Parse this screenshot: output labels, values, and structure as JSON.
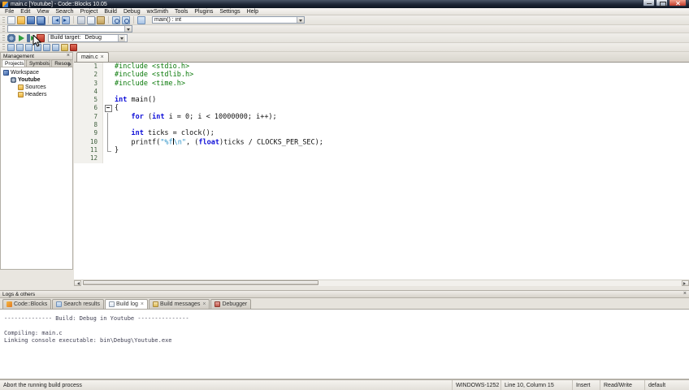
{
  "window": {
    "title": "main.c [Youtube] - Code::Blocks 10.05"
  },
  "glyphs": {
    "close": "×"
  },
  "colors": {
    "title_bar": "#1d2635",
    "keyword": "#0e0ed8",
    "preprocessor": "#0a7a0a",
    "string": "#2e93c8",
    "run_green": "#2f9e3f",
    "abort_red": "#b53224"
  },
  "menu_bar": {
    "items": [
      "File",
      "Edit",
      "View",
      "Search",
      "Project",
      "Build",
      "Debug",
      "wxSmith",
      "Tools",
      "Plugins",
      "Settings",
      "Help"
    ]
  },
  "toolbars": {
    "main_icons": [
      "new-file",
      "open-file",
      "save",
      "save-all",
      "|",
      "undo",
      "redo",
      "|",
      "cut",
      "copy",
      "paste",
      "|",
      "find",
      "replace",
      "|",
      "goto-line"
    ],
    "symbol_combo_value": "main() : int",
    "search_combo_value": "",
    "compiler_icons": [
      "build",
      "run",
      "build-and-run",
      "abort"
    ],
    "build_target_label": "Build target:",
    "build_target_value": "Debug",
    "debugger_icons": [
      "debug-continue",
      "run-to-cursor",
      "next-line",
      "step-into",
      "step-out",
      "next-instruction",
      "toggle-breakpoint",
      "stop-debugger"
    ]
  },
  "management": {
    "title": "Management",
    "tabs": [
      {
        "label": "Projects",
        "active": true
      },
      {
        "label": "Symbols"
      },
      {
        "label": "Resou"
      }
    ],
    "tree": [
      {
        "label": "Workspace",
        "icon": "workspace-icon",
        "indent": 0
      },
      {
        "label": "Youtube",
        "icon": "project-icon",
        "indent": 1,
        "bold": true
      },
      {
        "label": "Sources",
        "icon": "folder-icon",
        "indent": 2
      },
      {
        "label": "Headers",
        "icon": "folder-icon",
        "indent": 2
      }
    ]
  },
  "editor": {
    "tab_label": "main.c",
    "lines": [
      {
        "n": 1,
        "tokens": [
          [
            "pre",
            "#include <stdio.h>"
          ]
        ]
      },
      {
        "n": 2,
        "tokens": [
          [
            "pre",
            "#include <stdlib.h>"
          ]
        ]
      },
      {
        "n": 3,
        "tokens": [
          [
            "pre",
            "#include <time.h>"
          ]
        ]
      },
      {
        "n": 4,
        "tokens": []
      },
      {
        "n": 5,
        "tokens": [
          [
            "kw",
            "int"
          ],
          [
            "pl",
            " main()"
          ]
        ]
      },
      {
        "n": 6,
        "fold": "open",
        "tokens": [
          [
            "pl",
            "{"
          ]
        ]
      },
      {
        "n": 7,
        "fold": "line",
        "tokens": [
          [
            "pl",
            "    "
          ],
          [
            "kw",
            "for"
          ],
          [
            "pl",
            " ("
          ],
          [
            "kw",
            "int"
          ],
          [
            "pl",
            " i = "
          ],
          [
            "num",
            "0"
          ],
          [
            "pl",
            "; i < "
          ],
          [
            "num",
            "10000000"
          ],
          [
            "pl",
            "; i++);"
          ]
        ]
      },
      {
        "n": 8,
        "fold": "line",
        "tokens": []
      },
      {
        "n": 9,
        "fold": "line",
        "tokens": [
          [
            "pl",
            "    "
          ],
          [
            "kw",
            "int"
          ],
          [
            "pl",
            " ticks = clock();"
          ]
        ]
      },
      {
        "n": 10,
        "fold": "line",
        "tokens": [
          [
            "pl",
            "    printf("
          ],
          [
            "str",
            "\"%f"
          ],
          [
            "caret",
            ""
          ],
          [
            "str",
            "\\n\""
          ],
          [
            "pl",
            ", ("
          ],
          [
            "kw",
            "float"
          ],
          [
            "pl",
            ")ticks / CLOCKS_PER_SEC);"
          ]
        ]
      },
      {
        "n": 11,
        "fold": "end",
        "tokens": [
          [
            "pl",
            "}"
          ]
        ]
      },
      {
        "n": 12,
        "tokens": []
      }
    ]
  },
  "logs": {
    "title": "Logs & others",
    "tabs": [
      {
        "label": "Code::Blocks",
        "icon": "codeblocks-icon"
      },
      {
        "label": "Search results",
        "icon": "search-icon"
      },
      {
        "label": "Build log",
        "icon": "build-log-icon",
        "active": true,
        "closable": true
      },
      {
        "label": "Build messages",
        "icon": "build-messages-icon",
        "closable": true
      },
      {
        "label": "Debugger",
        "icon": "debugger-icon"
      }
    ],
    "lines": [
      "-------------- Build: Debug in Youtube ---------------",
      "",
      "Compiling: main.c",
      "Linking console executable: bin\\Debug\\Youtube.exe"
    ]
  },
  "status_bar": {
    "message": "Abort the running build process",
    "encoding": "WINDOWS-1252",
    "caret_position": "Line 10, Column 15",
    "overwrite_mode": "Insert",
    "file_mode": "Read/Write",
    "profile": "default"
  }
}
